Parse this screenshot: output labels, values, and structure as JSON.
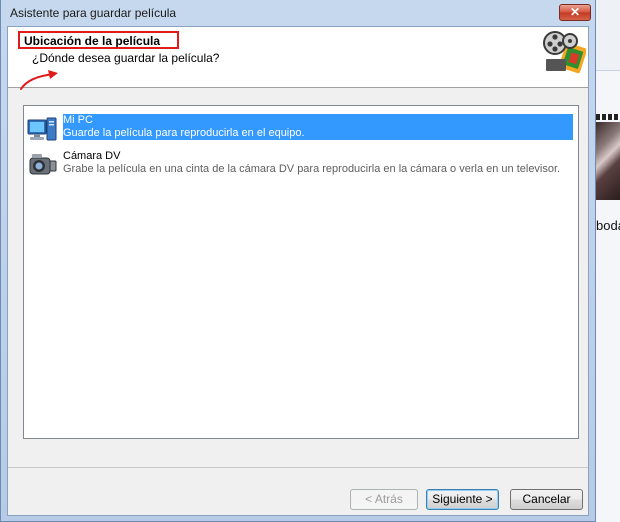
{
  "window": {
    "title": "Asistente para guardar película",
    "close_glyph": "✕"
  },
  "header": {
    "title": "Ubicación de la película",
    "subtitle": "¿Dónde desea guardar la película?",
    "film_icon": "movie-reel-icon",
    "annotation_color": "#e11b1b"
  },
  "list": {
    "items": [
      {
        "name": "Mi PC",
        "description": "Guarde la película para reproducirla en el equipo.",
        "icon": "computer-icon",
        "selected": true
      },
      {
        "name": "Cámara DV",
        "description": "Grabe la película en una cinta de la cámara DV para reproducirla en la cámara o verla en un televisor.",
        "icon": "camcorder-icon",
        "selected": false
      }
    ]
  },
  "buttons": {
    "back": "< Atrás",
    "next": "Siguiente >",
    "cancel": "Cancelar"
  },
  "background": {
    "label_fragment": "boda"
  },
  "colors": {
    "selection": "#3399ff",
    "highlight": "#e11b1b"
  }
}
